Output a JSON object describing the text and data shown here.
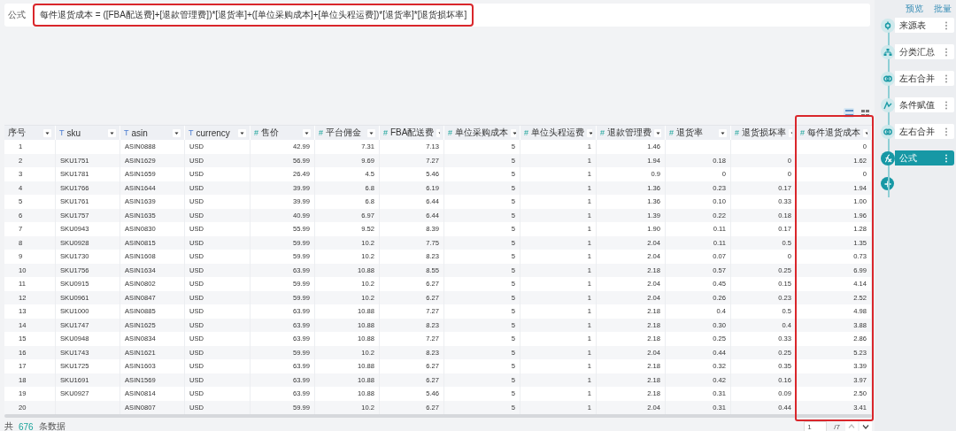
{
  "formula": {
    "label": "公式",
    "expression": "每件退货成本 = ([FBA配送费]+[退款管理费])*[退货率]+([单位采购成本]+[单位头程运费])*[退货率]*[退货损坏率]",
    "highlighted": true
  },
  "sidebar": {
    "links": [
      "预览",
      "批量"
    ],
    "steps": [
      {
        "label": "来源表",
        "kind": "source",
        "selected": false
      },
      {
        "label": "分类汇总",
        "kind": "group",
        "selected": false
      },
      {
        "label": "左右合并",
        "kind": "merge",
        "selected": false
      },
      {
        "label": "条件赋值",
        "kind": "assign",
        "selected": false
      },
      {
        "label": "左右合并",
        "kind": "merge",
        "selected": false
      },
      {
        "label": "公式",
        "kind": "formula",
        "selected": true
      }
    ]
  },
  "table": {
    "view_modes": [
      {
        "kind": "rows",
        "selected": true
      },
      {
        "kind": "grid",
        "selected": false
      }
    ],
    "columns": [
      {
        "label": "序号",
        "kind": "index",
        "highlighted": false
      },
      {
        "label": "sku",
        "kind": "text",
        "type_icon": "T",
        "highlighted": false
      },
      {
        "label": "asin",
        "kind": "text",
        "type_icon": "T",
        "highlighted": false
      },
      {
        "label": "currency",
        "kind": "text",
        "type_icon": "T",
        "highlighted": false
      },
      {
        "label": "售价",
        "kind": "number",
        "type_icon": "#",
        "highlighted": false
      },
      {
        "label": "平台佣金",
        "kind": "number",
        "type_icon": "#",
        "highlighted": false
      },
      {
        "label": "FBA配送费",
        "kind": "number",
        "type_icon": "#",
        "highlighted": false
      },
      {
        "label": "单位采购成本",
        "kind": "number",
        "type_icon": "#",
        "highlighted": false
      },
      {
        "label": "单位头程运费",
        "kind": "number",
        "type_icon": "#",
        "highlighted": false
      },
      {
        "label": "退款管理费",
        "kind": "number",
        "type_icon": "#",
        "highlighted": false
      },
      {
        "label": "退货率",
        "kind": "number",
        "type_icon": "#",
        "highlighted": false
      },
      {
        "label": "退货损坏率",
        "kind": "number",
        "type_icon": "#",
        "highlighted": false
      },
      {
        "label": "每件退货成本",
        "kind": "number",
        "type_icon": "#",
        "highlighted": true
      }
    ],
    "rows": [
      [
        "1",
        null,
        "ASIN0888",
        "USD",
        "42.99",
        "7.31",
        "7.13",
        "5",
        "1",
        "1.46",
        null,
        null,
        "0"
      ],
      [
        "2",
        "SKU1751",
        "ASIN1629",
        "USD",
        "56.99",
        "9.69",
        "7.27",
        "5",
        "1",
        "1.94",
        "0.18",
        "0",
        "1.62"
      ],
      [
        "3",
        "SKU1781",
        "ASIN1659",
        "USD",
        "26.49",
        "4.5",
        "5.46",
        "5",
        "1",
        "0.9",
        "0",
        "0",
        "0"
      ],
      [
        "4",
        "SKU1766",
        "ASIN1644",
        "USD",
        "39.99",
        "6.8",
        "6.19",
        "5",
        "1",
        "1.36",
        "0.23",
        "0.17",
        "1.94"
      ],
      [
        "5",
        "SKU1761",
        "ASIN1639",
        "USD",
        "39.99",
        "6.8",
        "6.44",
        "5",
        "1",
        "1.36",
        "0.10",
        "0.33",
        "1.00"
      ],
      [
        "6",
        "SKU1757",
        "ASIN1635",
        "USD",
        "40.99",
        "6.97",
        "6.44",
        "5",
        "1",
        "1.39",
        "0.22",
        "0.18",
        "1.96"
      ],
      [
        "7",
        "SKU0943",
        "ASIN0830",
        "USD",
        "55.99",
        "9.52",
        "8.39",
        "5",
        "1",
        "1.90",
        "0.11",
        "0.17",
        "1.28"
      ],
      [
        "8",
        "SKU0928",
        "ASIN0815",
        "USD",
        "59.99",
        "10.2",
        "7.75",
        "5",
        "1",
        "2.04",
        "0.11",
        "0.5",
        "1.35"
      ],
      [
        "9",
        "SKU1730",
        "ASIN1608",
        "USD",
        "59.99",
        "10.2",
        "8.23",
        "5",
        "1",
        "2.04",
        "0.07",
        "0",
        "0.73"
      ],
      [
        "10",
        "SKU1756",
        "ASIN1634",
        "USD",
        "63.99",
        "10.88",
        "8.55",
        "5",
        "1",
        "2.18",
        "0.57",
        "0.25",
        "6.99"
      ],
      [
        "11",
        "SKU0915",
        "ASIN0802",
        "USD",
        "59.99",
        "10.2",
        "6.27",
        "5",
        "1",
        "2.04",
        "0.45",
        "0.15",
        "4.14"
      ],
      [
        "12",
        "SKU0961",
        "ASIN0847",
        "USD",
        "59.99",
        "10.2",
        "6.27",
        "5",
        "1",
        "2.04",
        "0.26",
        "0.23",
        "2.52"
      ],
      [
        "13",
        "SKU1000",
        "ASIN0885",
        "USD",
        "63.99",
        "10.88",
        "7.27",
        "5",
        "1",
        "2.18",
        "0.4",
        "0.5",
        "4.98"
      ],
      [
        "14",
        "SKU1747",
        "ASIN1625",
        "USD",
        "63.99",
        "10.88",
        "8.23",
        "5",
        "1",
        "2.18",
        "0.30",
        "0.4",
        "3.88"
      ],
      [
        "15",
        "SKU0948",
        "ASIN0834",
        "USD",
        "63.99",
        "10.88",
        "7.27",
        "5",
        "1",
        "2.18",
        "0.25",
        "0.33",
        "2.86"
      ],
      [
        "16",
        "SKU1743",
        "ASIN1621",
        "USD",
        "59.99",
        "10.2",
        "8.23",
        "5",
        "1",
        "2.04",
        "0.44",
        "0.25",
        "5.23"
      ],
      [
        "17",
        "SKU1725",
        "ASIN1603",
        "USD",
        "63.99",
        "10.88",
        "6.27",
        "5",
        "1",
        "2.18",
        "0.32",
        "0.35",
        "3.39"
      ],
      [
        "18",
        "SKU1691",
        "ASIN1569",
        "USD",
        "63.99",
        "10.88",
        "6.27",
        "5",
        "1",
        "2.18",
        "0.42",
        "0.16",
        "3.97"
      ],
      [
        "19",
        "SKU0927",
        "ASIN0814",
        "USD",
        "63.99",
        "10.88",
        "5.46",
        "5",
        "1",
        "2.18",
        "0.31",
        "0.09",
        "2.50"
      ],
      [
        "20",
        null,
        "ASIN0807",
        "USD",
        "59.99",
        "10.2",
        "6.27",
        "5",
        "1",
        "2.04",
        "0.31",
        "0.44",
        "3.41"
      ]
    ]
  },
  "footer": {
    "prefix": "共",
    "count": "676",
    "suffix": "条数据",
    "page": "1",
    "pages": "/7"
  }
}
